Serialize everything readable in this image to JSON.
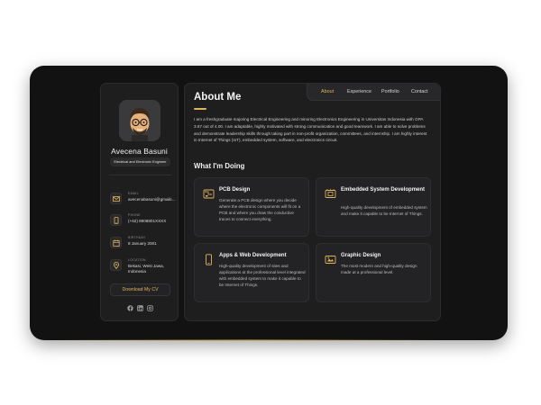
{
  "profile": {
    "name": "Avecena Basuni",
    "title": "Electrical and Electronic Engineer"
  },
  "contacts": [
    {
      "label": "Email",
      "value": "avecenabasuni@gmailc...",
      "icon": "mail-icon"
    },
    {
      "label": "Phone",
      "value": "(+62) 8908801XXXX",
      "icon": "phone-icon"
    },
    {
      "label": "Birthday",
      "value": "8 January 2001",
      "icon": "calendar-icon"
    },
    {
      "label": "Location",
      "value": "Bekasi, West Jawa, Indonesia",
      "icon": "location-pin-icon"
    }
  ],
  "cv_button": "Download My CV",
  "socials": [
    "facebook-icon",
    "linkedin-icon",
    "instagram-icon"
  ],
  "nav": {
    "tabs": [
      "About",
      "Experience",
      "Portfolio",
      "Contact"
    ],
    "active": "About"
  },
  "about": {
    "title": "About Me",
    "text": "I am a freshgraduate majoring Electrical Engineering and minoring Electronics Engineering in Universitas Indonesia with GPA 3.67 out of 4.00. I am adaptable, highly motivated with strong communication and good teamwork. I am able to solve problems and demonstrate leadership skills through taking part in non-profit organization, committees, and internship. I am highly interest in Internet of Things (IoT), embedded system, software, and electronics circuit."
  },
  "doing": {
    "title": "What I'm Doing",
    "services": [
      {
        "title": "PCB Design",
        "description": "Generate a PCB design where you decide where the electronic components will fit on a PCB and where you draw the conductive traces to connect everything.",
        "icon": "pcb-icon"
      },
      {
        "title": "Embedded System Development",
        "description": "High-quality development of embedded system and make it capable to be Internet of Things.",
        "icon": "chip-icon"
      },
      {
        "title": "Apps & Web Development",
        "description": "High-quality development of sites and applications at the professional level integrated with embedded system to make it capable to be Internet of Things.",
        "icon": "mobile-icon"
      },
      {
        "title": "Graphic Design",
        "description": "The most modern and high-quality design made at a professional level.",
        "icon": "design-icon"
      }
    ]
  },
  "colors": {
    "accent": "#e0b45a",
    "background": "#121212",
    "panel": "#1e1e1f",
    "card": "#232325"
  }
}
